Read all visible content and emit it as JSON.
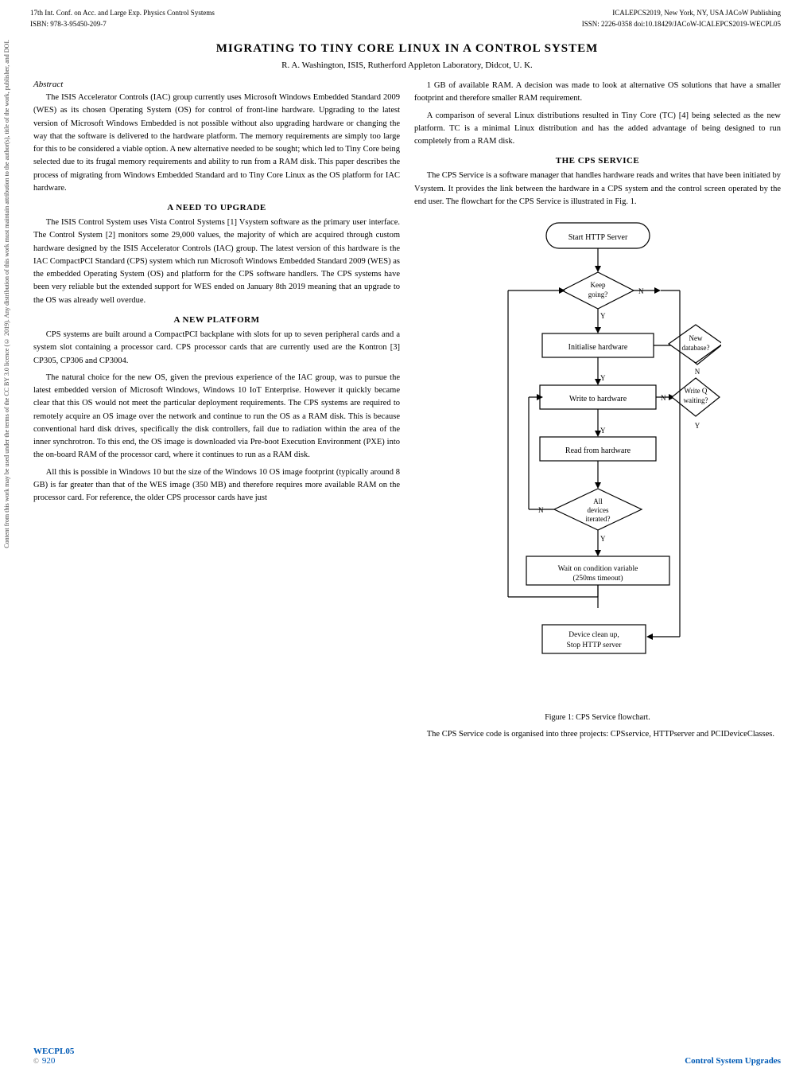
{
  "header": {
    "left_line1": "17th Int. Conf. on Acc. and Large Exp. Physics Control Systems",
    "left_line2": "ISBN: 978-3-95450-209-7",
    "right_line1": "ICALEPCS2019, New York, NY, USA      JACoW Publishing",
    "right_line2": "ISSN: 2226-0358          doi:10.18429/JACoW-ICALEPCS2019-WECPL05"
  },
  "sidebar": {
    "lines": [
      "Content from this work may be used under the terms of the CC BY 3.0 licence (© 2019). Any distribution of this work must maintain attribution to the author(s), title of the work, publisher, and DOI."
    ]
  },
  "title": "MIGRATING TO TINY CORE LINUX IN A CONTROL SYSTEM",
  "authors": "R. A. Washington, ISIS, Rutherford Appleton Laboratory, Didcot, U. K.",
  "abstract": {
    "title": "Abstract",
    "paragraphs": [
      "The ISIS Accelerator Controls (IAC) group currently uses Microsoft Windows Embedded Standard 2009 (WES) as its chosen Operating System (OS) for control of front-line hardware. Upgrading to the latest version of Microsoft Windows Embedded is not possible without also upgrading hardware or changing the way that the software is delivered to the hardware platform. The memory requirements are simply too large for this to be considered a viable option. A new alternative needed to be sought; which led to Tiny Core being selected due to its frugal memory requirements and ability to run from a RAM disk. This paper describes the process of migrating from Windows Embedded Standard ard to Tiny Core Linux as the OS platform for IAC hardware."
    ]
  },
  "sections": {
    "need_to_upgrade": {
      "title": "A NEED TO UPGRADE",
      "paragraphs": [
        "The ISIS Control System uses Vista Control Systems [1] Vsystem software as the primary user interface. The Control System [2] monitors some 29,000 values, the majority of which are acquired through custom hardware designed by the ISIS Accelerator Controls (IAC) group. The latest version of this hardware is the IAC CompactPCI Standard (CPS) system which run Microsoft Windows Embedded Standard 2009 (WES) as the embedded Operating System (OS) and platform for the CPS software handlers. The CPS systems have been very reliable but the extended support for WES ended on January 8th 2019 meaning that an upgrade to the OS was already well overdue."
      ]
    },
    "new_platform": {
      "title": "A NEW PLATFORM",
      "paragraphs": [
        "CPS systems are built around a CompactPCI backplane with slots for up to seven peripheral cards and a system slot containing a processor card. CPS processor cards that are currently used are the Kontron [3] CP305, CP306 and CP3004.",
        "The natural choice for the new OS, given the previous experience of the IAC group, was to pursue the latest embedded version of Microsoft Windows, Windows 10 IoT Enterprise. However it quickly became clear that this OS would not meet the particular deployment requirements. The CPS systems are required to remotely acquire an OS image over the network and continue to run the OS as a RAM disk. This is because conventional hard disk drives, specifically the disk controllers, fail due to radiation within the area of the inner synchrotron. To this end, the OS image is downloaded via Pre-boot Execution Environment (PXE) into the on-board RAM of the processor card, where it continues to run as a RAM disk.",
        "All this is possible in Windows 10 but the size of the Windows 10 OS image footprint (typically around 8 GB) is far greater than that of the WES image (350 MB) and therefore requires more available RAM on the processor card. For reference, the older CPS processor cards have just"
      ]
    },
    "right_col": {
      "paragraphs": [
        "1 GB of available RAM. A decision was made to look at alternative OS solutions that have a smaller footprint and therefore smaller RAM requirement.",
        "A comparison of several Linux distributions resulted in Tiny Core (TC) [4] being selected as the new platform. TC is a minimal Linux distribution and has the added advantage of being designed to run completely from a RAM disk."
      ]
    },
    "cps_service": {
      "title": "THE CPS SERVICE",
      "paragraphs": [
        "The CPS Service is a software manager that handles hardware reads and writes that have been initiated by Vsystem. It provides the link between the hardware in a CPS system and the control screen operated by the end user. The flowchart for the CPS Service is illustrated in Fig. 1.",
        "The CPS Service code is organised into three projects: CPSservice, HTTPserver and PCIDeviceClasses."
      ]
    }
  },
  "flowchart": {
    "caption": "Figure 1: CPS Service flowchart.",
    "nodes": {
      "start": "Start HTTP Server",
      "keep_going": "Keep\ngoing?",
      "initialise": "Initialise hardware",
      "new_database": "New\ndatabase?",
      "write_hardware": "Write to hardware",
      "write_q": "Write Q\nwaiting?",
      "read_hardware": "Read from hardware",
      "all_devices": "All\ndevices\niterated?",
      "wait_condition": "Wait on condition variable\n(250ms timeout)",
      "device_clean": "Device clean up,\nStop HTTP server"
    },
    "labels": {
      "n1": "N",
      "y1": "Y",
      "y2": "Y",
      "n2": "N",
      "y3": "Y",
      "n3": "N",
      "y4": "Y",
      "n4": "N"
    }
  },
  "footer": {
    "wecpl": "WECPL05",
    "page_num": "920",
    "right_label": "Control System Upgrades",
    "cc_symbol": "©"
  }
}
